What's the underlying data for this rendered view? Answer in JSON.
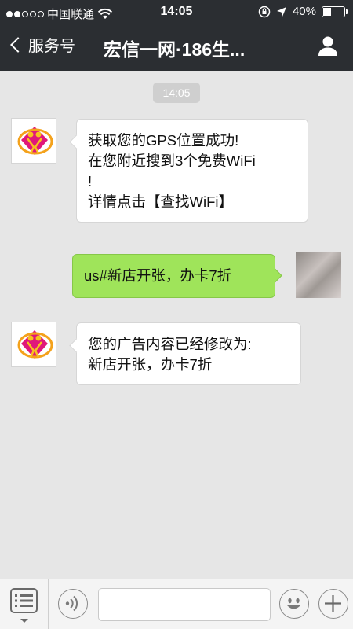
{
  "status_bar": {
    "carrier": "中国联通",
    "time": "14:05",
    "battery_percent": "40%",
    "battery_level": 0.4,
    "signal_bars": 2
  },
  "nav": {
    "back_label": "服务号",
    "title": "宏信一网·186生..."
  },
  "chat": {
    "timestamp": "14:05",
    "messages": [
      {
        "from": "account",
        "lines": [
          "获取您的GPS位置成功!",
          "在您附近搜到3个免费WiFi",
          "!",
          "详情点击【查找WiFi】"
        ]
      },
      {
        "from": "user",
        "lines": [
          "us#新店开张，办卡7折"
        ]
      },
      {
        "from": "account",
        "lines": [
          "您的广告内容已经修改为:",
          "新店开张，办卡7折"
        ]
      }
    ]
  },
  "input": {
    "placeholder": ""
  },
  "colors": {
    "nav_bg": "#2b2e32",
    "chat_bg": "#e6e6e6",
    "outgoing_bubble": "#9fe45a",
    "incoming_bubble": "#ffffff"
  },
  "icons": {
    "menu": "list-menu-icon",
    "voice": "voice-icon",
    "emoji": "emoji-icon",
    "plus": "plus-icon",
    "profile": "person-icon"
  }
}
